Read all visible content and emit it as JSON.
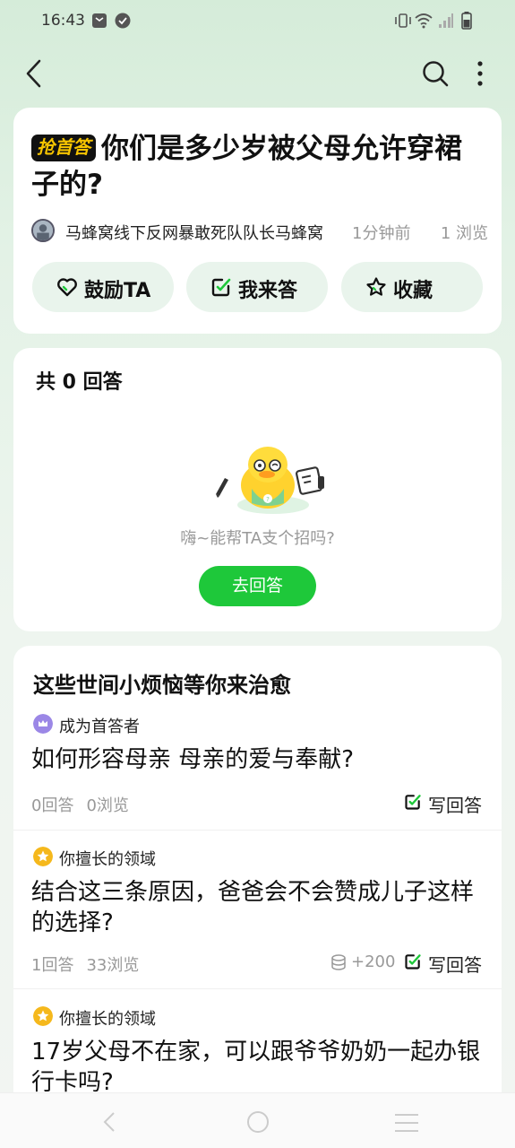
{
  "status": {
    "time": "16:43"
  },
  "question": {
    "badge": "抢首答",
    "title": "你们是多少岁被父母允许穿裙子的?",
    "author": "马蜂窝线下反网暴敢死队队长马蜂窝",
    "time_ago": "1分钟前",
    "views": "1 浏览"
  },
  "actions": {
    "encourage": "鼓励TA",
    "answer": "我来答",
    "favorite": "收藏"
  },
  "answers": {
    "count_label": "共 0 回答",
    "hint": "嗨~能帮TA支个招吗?",
    "go_answer": "去回答"
  },
  "recommend": {
    "title": "这些世间小烦恼等你来治愈",
    "items": [
      {
        "tag": "成为首答者",
        "question": "如何形容母亲 母亲的爱与奉献?",
        "answers": "0回答",
        "views": "0浏览",
        "reward": "",
        "write": "写回答"
      },
      {
        "tag": "你擅长的领域",
        "question": "结合这三条原因，爸爸会不会赞成儿子这样的选择?",
        "answers": "1回答",
        "views": "33浏览",
        "reward": "+200",
        "write": "写回答"
      },
      {
        "tag": "你擅长的领域",
        "question": "17岁父母不在家，可以跟爷爷奶奶一起办银行卡吗?",
        "answers": "",
        "views": "",
        "reward": "",
        "write": ""
      }
    ]
  },
  "colors": {
    "accent": "#1ec83a",
    "bg_top": "#d5ecd9",
    "button_bg": "#e9f4ec"
  },
  "icons": [
    "back-icon",
    "search-icon",
    "more-icon",
    "heart-icon",
    "edit-icon",
    "star-icon",
    "crown-icon",
    "coin-icon"
  ]
}
